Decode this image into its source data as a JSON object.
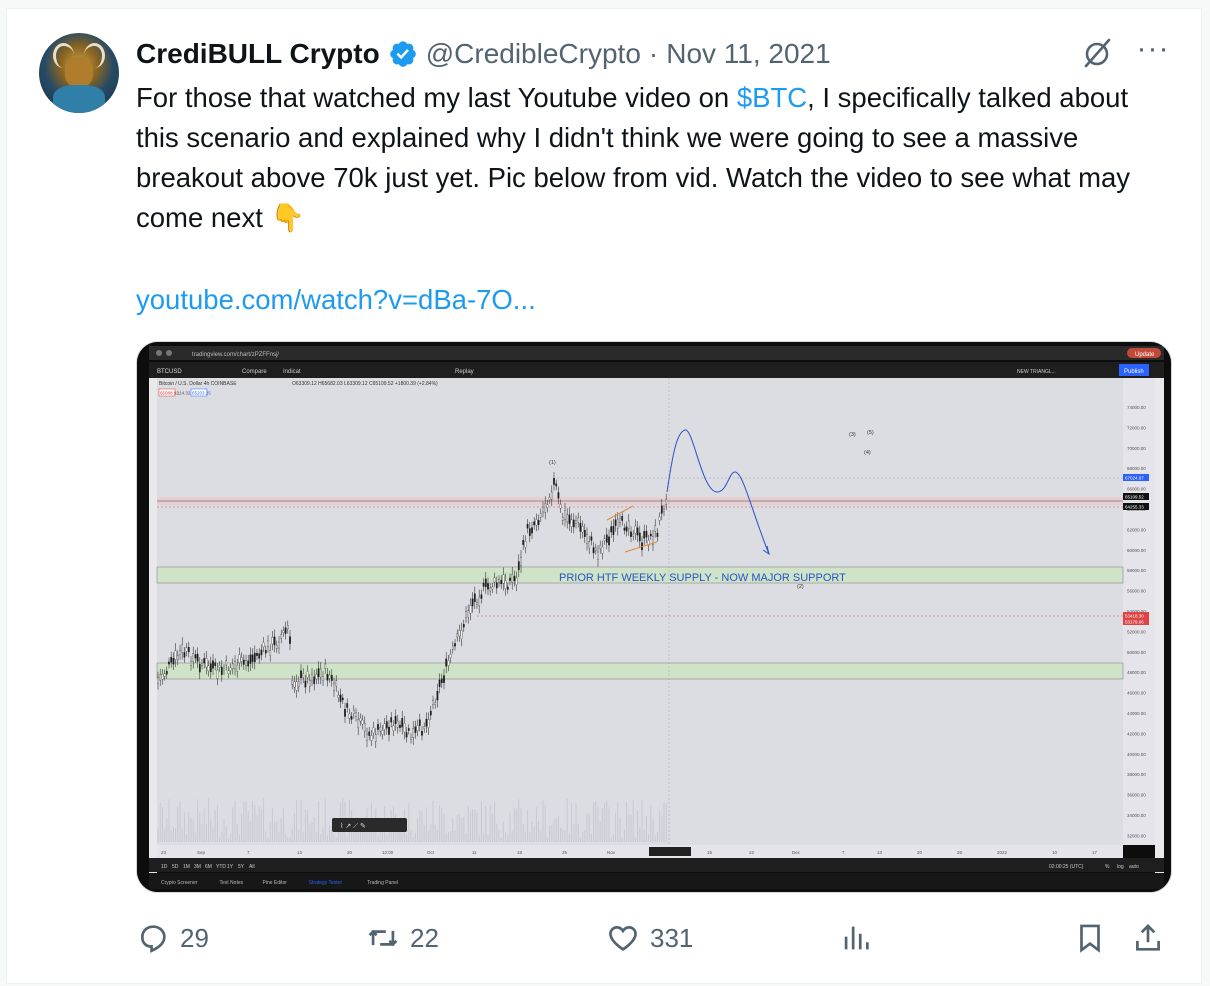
{
  "tweet": {
    "author_name": "CrediBULL Crypto",
    "handle": "@CredibleCrypto",
    "separator": "·",
    "date": "Nov 11, 2021",
    "text_before_cashtag": "For those that watched my last Youtube video on ",
    "cashtag": "$BTC",
    "text_after_cashtag": ", I specifically talked about this scenario and explained why I didn't think we were going to see a massive breakout above 70k just yet. Pic below from vid. Watch the video to see what may come next ",
    "emoji": "👇",
    "link": "youtube.com/watch?v=dBa-7O..."
  },
  "icons": {
    "verified": "verified-badge-icon",
    "grok": "grok-icon",
    "more": "more-icon"
  },
  "more_label": "···",
  "actions": {
    "replies": "29",
    "reposts": "22",
    "likes": "331"
  },
  "chart": {
    "url": "tradingview.com/chart/zPZFFnsj/",
    "symbol": "BTCUSD",
    "title_line": "Bitcoin / U.S. Dollar  4h  COINBASE",
    "ohlc": "O63309.12 H65682.03 L63309.12 C65109.52 +1800.39 (+2.84%)",
    "price_a": "65088.92",
    "price_b": "114.32",
    "price_c": "65203.25",
    "toolbar_replay": "Replay",
    "toolbar_compare": "Compare",
    "toolbar_indicators": "Indicat",
    "top_right_label": "NEW TRIANGL...",
    "publish": "Publish",
    "update": "Update",
    "annotation": "PRIOR HTF WEEKLY SUPPLY -   NOW MAJOR SUPPORT",
    "wave_labels": [
      "(1)",
      "(3)",
      "(5)",
      "(4)",
      "(2)"
    ],
    "price_ticks": [
      "74000.00",
      "72000.00",
      "70000.00",
      "68000.00",
      "66000.00",
      "64000.00",
      "62000.00",
      "60000.00",
      "58000.00",
      "56000.00",
      "54000.00",
      "52000.00",
      "50000.00",
      "48000.00",
      "46000.00",
      "44000.00",
      "42000.00",
      "40000.00",
      "38000.00",
      "36000.00",
      "34000.00",
      "32000.00"
    ],
    "price_tags": [
      "67024.97",
      "65109.52",
      "64255.33",
      "53418.30",
      "53179.06"
    ],
    "date_ticks": [
      "23",
      "Sep",
      "7",
      "13",
      "20",
      "12:00",
      "Oct",
      "11",
      "18",
      "25",
      "Nov",
      "08 Nov '21  08:00",
      "15",
      "22",
      "Dec",
      "7",
      "13",
      "20",
      "26",
      "2022",
      "10",
      "17"
    ],
    "periods": [
      "1D",
      "5D",
      "1M",
      "3M",
      "6M",
      "YTD",
      "1Y",
      "5Y",
      "All"
    ],
    "clock": "02:00:25 (UTC)",
    "bottom_right": [
      "%",
      "log",
      "auto"
    ],
    "bottom_tabs": [
      "Crypto Screener",
      "Text Notes",
      "Pine Editor",
      "Strategy Tester",
      "Trading Panel"
    ]
  }
}
